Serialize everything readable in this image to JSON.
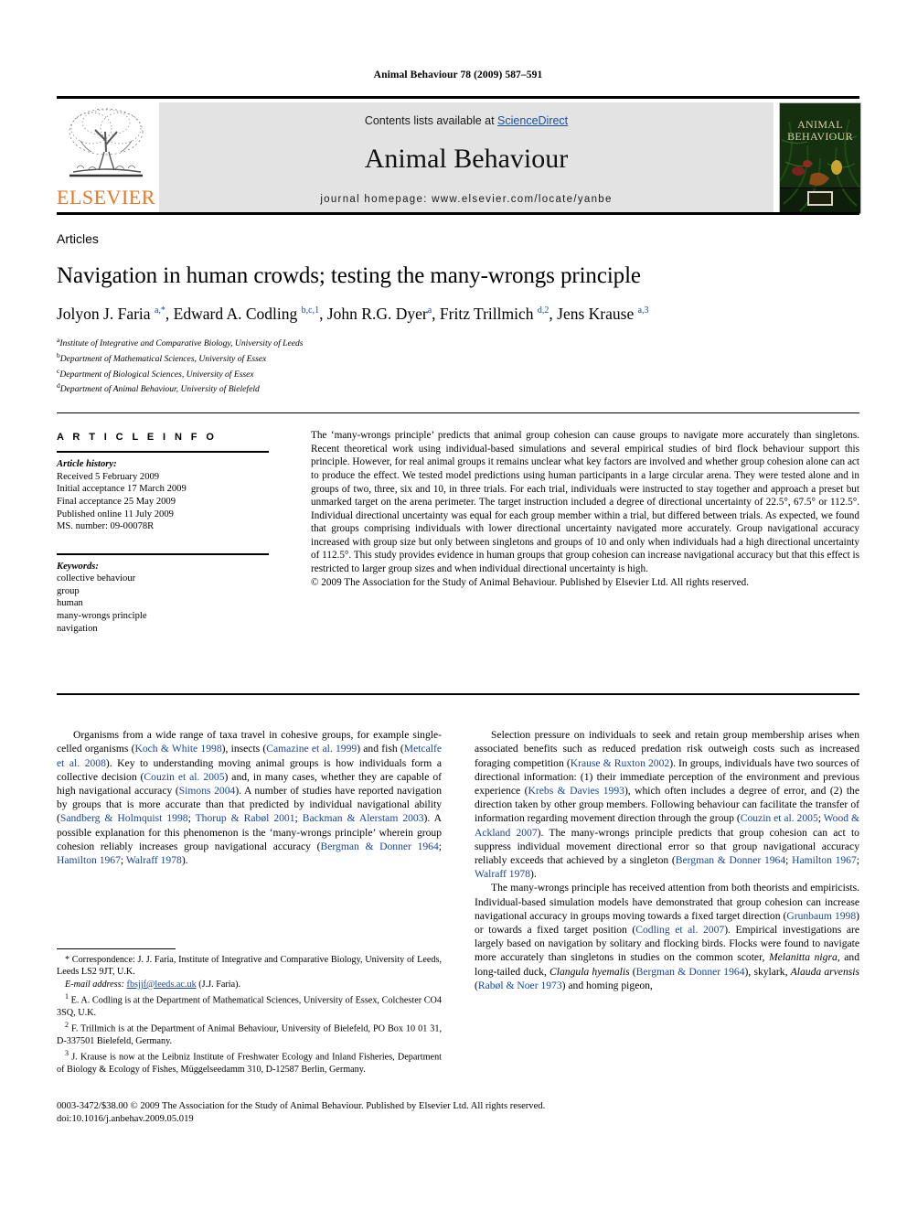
{
  "running_head": "Animal Behaviour 78 (2009) 587–591",
  "masthead": {
    "contents_prefix": "Contents lists available at ",
    "sciencedirect": "ScienceDirect",
    "journal_title": "Animal Behaviour",
    "homepage": "journal homepage: www.elsevier.com/locate/yanbe",
    "publisher_logo_text": "ELSEVIER",
    "cover_title_line1": "ANIMAL",
    "cover_title_line2": "BEHAVIOUR"
  },
  "section_label": "Articles",
  "title": "Navigation in human crowds; testing the many-wrongs principle",
  "authors_html": "Jolyon J. Faria <sup>a,*</sup>, Edward A. Codling <sup>b,c,1</sup>, John R.G. Dyer<sup>a</sup>, Fritz Trillmich <sup>d,2</sup>, Jens Krause <sup>a,3</sup>",
  "affiliations": [
    {
      "marker": "a",
      "text": "Institute of Integrative and Comparative Biology, University of Leeds"
    },
    {
      "marker": "b",
      "text": "Department of Mathematical Sciences, University of Essex"
    },
    {
      "marker": "c",
      "text": "Department of Biological Sciences, University of Essex"
    },
    {
      "marker": "d",
      "text": "Department of Animal Behaviour, University of Bielefeld"
    }
  ],
  "article_info": {
    "heading": "A R T I C L E  I N F O",
    "history_label": "Article history:",
    "history": [
      "Received 5 February 2009",
      "Initial acceptance 17 March 2009",
      "Final acceptance 25 May 2009",
      "Published online 11 July 2009",
      "MS. number: 09-00078R"
    ],
    "keywords_label": "Keywords:",
    "keywords": [
      "collective behaviour",
      "group",
      "human",
      "many-wrongs principle",
      "navigation"
    ]
  },
  "abstract": {
    "text": "The ‘many-wrongs principle’ predicts that animal group cohesion can cause groups to navigate more accurately than singletons. Recent theoretical work using individual-based simulations and several empirical studies of bird flock behaviour support this principle. However, for real animal groups it remains unclear what key factors are involved and whether group cohesion alone can act to produce the effect. We tested model predictions using human participants in a large circular arena. They were tested alone and in groups of two, three, six and 10, in three trials. For each trial, individuals were instructed to stay together and approach a preset but unmarked target on the arena perimeter. The target instruction included a degree of directional uncertainty of 22.5°, 67.5° or 112.5°. Individual directional uncertainty was equal for each group member within a trial, but differed between trials. As expected, we found that groups comprising individuals with lower directional uncertainty navigated more accurately. Group navigational accuracy increased with group size but only between singletons and groups of 10 and only when individuals had a high directional uncertainty of 112.5°. This study provides evidence in human groups that group cohesion can increase navigational accuracy but that this effect is restricted to larger group sizes and when individual directional uncertainty is high.",
    "copyright": "© 2009 The Association for the Study of Animal Behaviour. Published by Elsevier Ltd. All rights reserved."
  },
  "body": {
    "left_paragraphs": [
      "Organisms from a wide range of taxa travel in cohesive groups, for example single-celled organisms (Koch & White 1998), insects (Camazine et al. 1999) and fish (Metcalfe et al. 2008). Key to understanding moving animal groups is how individuals form a collective decision (Couzin et al. 2005) and, in many cases, whether they are capable of high navigational accuracy (Simons 2004). A number of studies have reported navigation by groups that is more accurate than that predicted by individual navigational ability (Sandberg & Holmquist 1998; Thorup & Rabøl 2001; Backman & Alerstam 2003). A possible explanation for this phenomenon is the ‘many-wrongs principle’ wherein group cohesion reliably increases group navigational accuracy (Bergman & Donner 1964; Hamilton 1967; Walraff 1978)."
    ],
    "right_paragraphs": [
      "Selection pressure on individuals to seek and retain group membership arises when associated benefits such as reduced predation risk outweigh costs such as increased foraging competition (Krause & Ruxton 2002). In groups, individuals have two sources of directional information: (1) their immediate perception of the environment and previous experience (Krebs & Davies 1993), which often includes a degree of error, and (2) the direction taken by other group members. Following behaviour can facilitate the transfer of information regarding movement direction through the group (Couzin et al. 2005; Wood & Ackland 2007). The many-wrongs principle predicts that group cohesion can act to suppress individual movement directional error so that group navigational accuracy reliably exceeds that achieved by a singleton (Bergman & Donner 1964; Hamilton 1967; Walraff 1978).",
      "The many-wrongs principle has received attention from both theorists and empiricists. Individual-based simulation models have demonstrated that group cohesion can increase navigational accuracy in groups moving towards a fixed target direction (Grunbaum 1998) or towards a fixed target position (Codling et al. 2007). Empirical investigations are largely based on navigation by solitary and flocking birds. Flocks were found to navigate more accurately than singletons in studies on the common scoter, Melanitta nigra, and long-tailed duck, Clangula hyemalis (Bergman & Donner 1964), skylark, Alauda arvensis (Rabøl & Noer 1973) and homing pigeon,"
    ]
  },
  "footnotes": {
    "correspondence": "* Correspondence: J. J. Faria, Institute of Integrative and Comparative Biology, University of Leeds, Leeds LS2 9JT, U.K.",
    "email_label": "E-mail address:",
    "email": "fbsjjf@leeds.ac.uk",
    "email_suffix": "(J.J. Faria).",
    "note1": "E. A. Codling is at the Department of Mathematical Sciences, University of Essex, Colchester CO4 3SQ, U.K.",
    "note2": "F. Trillmich is at the Department of Animal Behaviour, University of Bielefeld, PO Box 10 01 31, D-337501 Bielefeld, Germany.",
    "note3": "J. Krause is now at the Leibniz Institute of Freshwater Ecology and Inland Fisheries, Department of Biology & Ecology of Fishes, Müggelseedamm 310, D-12587 Berlin, Germany."
  },
  "footer": {
    "line1": "0003-3472/$38.00 © 2009 The Association for the Study of Animal Behaviour. Published by Elsevier Ltd. All rights reserved.",
    "line2": "doi:10.1016/j.anbehav.2009.05.019"
  },
  "colors": {
    "citation_blue": "#16449a",
    "link_blue": "#1a4f9c",
    "elsevier_orange": "#e87722",
    "banner_grey": "#e3e3e3"
  }
}
